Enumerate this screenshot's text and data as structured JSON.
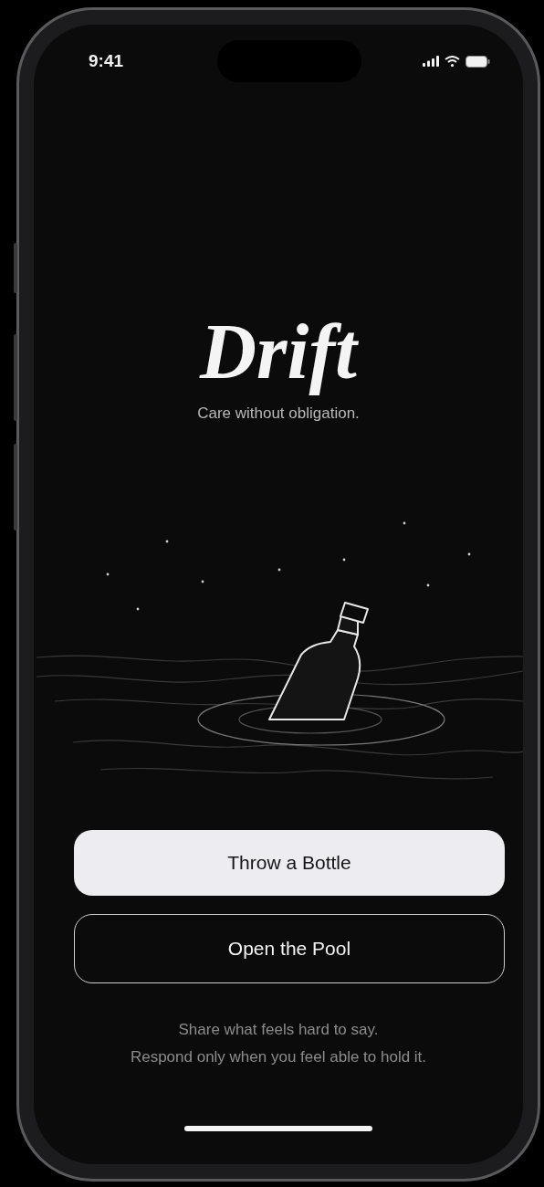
{
  "status_bar": {
    "time": "9:41"
  },
  "title": "Drift",
  "tagline": "Care without obligation.",
  "buttons": [
    {
      "label": "Throw a Bottle",
      "kind": "primary"
    },
    {
      "label": "Open the Pool",
      "kind": "secondary"
    }
  ],
  "footer_lines": [
    "Share what feels hard to say.",
    "Respond only when you feel able to hold it."
  ]
}
